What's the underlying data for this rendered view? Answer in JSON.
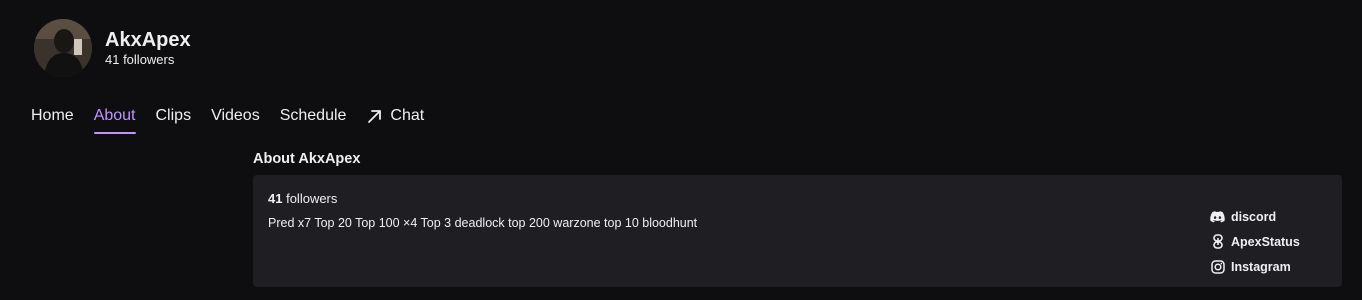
{
  "channel": {
    "name": "AkxApex",
    "followers_text": "41 followers",
    "avatar_icon": "user-avatar"
  },
  "tabs": [
    {
      "label": "Home",
      "active": false
    },
    {
      "label": "About",
      "active": true
    },
    {
      "label": "Clips",
      "active": false
    },
    {
      "label": "Videos",
      "active": false
    },
    {
      "label": "Schedule",
      "active": false
    },
    {
      "label": "Chat",
      "active": false,
      "icon": "arrow-up-right-icon"
    }
  ],
  "about": {
    "title": "About AkxApex",
    "follower_count": "41",
    "follower_label": "followers",
    "bio": "Pred x7 Top 20 Top 100 ×4 Top 3 deadlock top 200 warzone top 10 bloodhunt"
  },
  "social_links": [
    {
      "label": "discord",
      "icon": "discord-icon"
    },
    {
      "label": "ApexStatus",
      "icon": "link-icon"
    },
    {
      "label": "Instagram",
      "icon": "instagram-icon"
    }
  ],
  "colors": {
    "background": "#0e0e10",
    "panel": "#1f1f23",
    "accent": "#bf94ff",
    "text": "#efeff1"
  }
}
